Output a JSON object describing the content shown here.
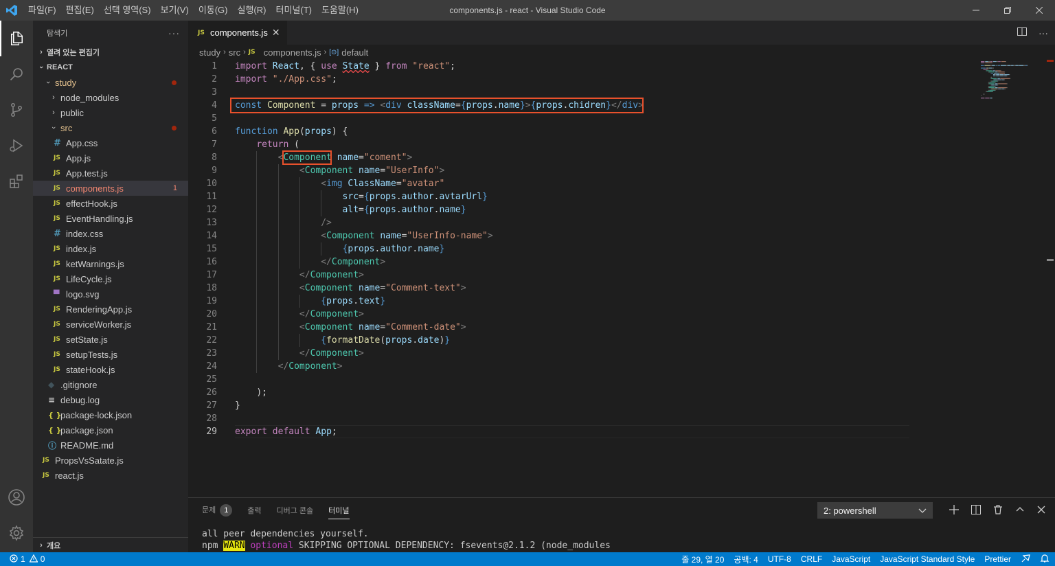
{
  "window": {
    "title": "components.js - react - Visual Studio Code",
    "menu": [
      "파일(F)",
      "편집(E)",
      "선택 영역(S)",
      "보기(V)",
      "이동(G)",
      "실행(R)",
      "터미널(T)",
      "도움말(H)"
    ]
  },
  "sidebar": {
    "title": "탐색기",
    "more": "···",
    "open_editors": "열려 있는 편집기",
    "workspace": "REACT",
    "outline": "개요",
    "tree": [
      {
        "label": "study",
        "type": "folder-open",
        "depth": 1,
        "status": "mod",
        "dot": true
      },
      {
        "label": "node_modules",
        "type": "folder",
        "depth": 2
      },
      {
        "label": "public",
        "type": "folder",
        "depth": 2
      },
      {
        "label": "src",
        "type": "folder-open",
        "depth": 2,
        "status": "mod",
        "dot": true
      },
      {
        "label": "App.css",
        "type": "css",
        "depth": 3
      },
      {
        "label": "App.js",
        "type": "js",
        "depth": 3
      },
      {
        "label": "App.test.js",
        "type": "js",
        "depth": 3
      },
      {
        "label": "components.js",
        "type": "js",
        "depth": 3,
        "status": "err",
        "badge": "1",
        "selected": true
      },
      {
        "label": "effectHook.js",
        "type": "js",
        "depth": 3
      },
      {
        "label": "EventHandling.js",
        "type": "js",
        "depth": 3
      },
      {
        "label": "index.css",
        "type": "css",
        "depth": 3
      },
      {
        "label": "index.js",
        "type": "js",
        "depth": 3
      },
      {
        "label": "ketWarnings.js",
        "type": "js",
        "depth": 3
      },
      {
        "label": "LifeCycle.js",
        "type": "js",
        "depth": 3
      },
      {
        "label": "logo.svg",
        "type": "svg",
        "depth": 3
      },
      {
        "label": "RenderingApp.js",
        "type": "js",
        "depth": 3
      },
      {
        "label": "serviceWorker.js",
        "type": "js",
        "depth": 3
      },
      {
        "label": "setState.js",
        "type": "js",
        "depth": 3
      },
      {
        "label": "setupTests.js",
        "type": "js",
        "depth": 3
      },
      {
        "label": "stateHook.js",
        "type": "js",
        "depth": 3
      },
      {
        "label": ".gitignore",
        "type": "git",
        "depth": 2
      },
      {
        "label": "debug.log",
        "type": "log",
        "depth": 2
      },
      {
        "label": "package-lock.json",
        "type": "json",
        "depth": 2
      },
      {
        "label": "package.json",
        "type": "json",
        "depth": 2
      },
      {
        "label": "README.md",
        "type": "info",
        "depth": 2
      },
      {
        "label": "PropsVsSatate.js",
        "type": "js",
        "depth": 1
      },
      {
        "label": "react.js",
        "type": "js",
        "depth": 1
      }
    ]
  },
  "editor": {
    "tab": "components.js",
    "breadcrumb": [
      "study",
      "src",
      "components.js",
      "default"
    ],
    "lines": [
      [
        [
          "kw2",
          "import"
        ],
        [
          "cm",
          " "
        ],
        [
          "var",
          "React"
        ],
        [
          "pun",
          ", { "
        ],
        [
          "kw2",
          "use"
        ],
        [
          "cm",
          " "
        ],
        [
          "var squig",
          "State"
        ],
        [
          "pun",
          " } "
        ],
        [
          "kw2",
          "from"
        ],
        [
          "cm",
          " "
        ],
        [
          "str",
          "\"react\""
        ],
        [
          "pun",
          ";"
        ]
      ],
      [
        [
          "kw2",
          "import"
        ],
        [
          "cm",
          " "
        ],
        [
          "str",
          "\"./App.css\""
        ],
        [
          "pun",
          ";"
        ]
      ],
      [],
      [
        [
          "kw",
          "const"
        ],
        [
          "cm",
          " "
        ],
        [
          "fn",
          "Component"
        ],
        [
          "pun",
          " = "
        ],
        [
          "var",
          "props"
        ],
        [
          "cm",
          " "
        ],
        [
          "kw",
          "=>"
        ],
        [
          "cm",
          " "
        ],
        [
          "br",
          "<"
        ],
        [
          "kw",
          "div"
        ],
        [
          "cm",
          " "
        ],
        [
          "var",
          "className"
        ],
        [
          "pun",
          "="
        ],
        [
          "jb",
          "{"
        ],
        [
          "var",
          "props"
        ],
        [
          "pun",
          "."
        ],
        [
          "var",
          "name"
        ],
        [
          "jb",
          "}"
        ],
        [
          "br",
          ">"
        ],
        [
          "jb",
          "{"
        ],
        [
          "var",
          "props"
        ],
        [
          "pun",
          "."
        ],
        [
          "var",
          "chidren"
        ],
        [
          "jb",
          "}"
        ],
        [
          "br",
          "</"
        ],
        [
          "kw",
          "div"
        ],
        [
          "br",
          ">"
        ]
      ],
      [],
      [
        [
          "kw",
          "function"
        ],
        [
          "cm",
          " "
        ],
        [
          "fn",
          "App"
        ],
        [
          "pun",
          "("
        ],
        [
          "var",
          "props"
        ],
        [
          "pun",
          ") {"
        ]
      ],
      [
        [
          "cm",
          "    "
        ],
        [
          "kw2",
          "return"
        ],
        [
          "pun",
          " ("
        ]
      ],
      [
        [
          "cm",
          "        "
        ],
        [
          "br",
          "<"
        ],
        [
          "tag",
          "Component"
        ],
        [
          "cm",
          " "
        ],
        [
          "var",
          "name"
        ],
        [
          "pun",
          "="
        ],
        [
          "str",
          "\"coment\""
        ],
        [
          "br",
          ">"
        ]
      ],
      [
        [
          "cm",
          "            "
        ],
        [
          "br",
          "<"
        ],
        [
          "tag",
          "Component"
        ],
        [
          "cm",
          " "
        ],
        [
          "var",
          "name"
        ],
        [
          "pun",
          "="
        ],
        [
          "str",
          "\"UserInfo\""
        ],
        [
          "br",
          ">"
        ]
      ],
      [
        [
          "cm",
          "                "
        ],
        [
          "br",
          "<"
        ],
        [
          "kw",
          "img"
        ],
        [
          "cm",
          " "
        ],
        [
          "var",
          "ClassName"
        ],
        [
          "pun",
          "="
        ],
        [
          "str",
          "\"avatar\""
        ]
      ],
      [
        [
          "cm",
          "                    "
        ],
        [
          "var",
          "src"
        ],
        [
          "pun",
          "="
        ],
        [
          "jb",
          "{"
        ],
        [
          "var",
          "props"
        ],
        [
          "pun",
          "."
        ],
        [
          "var",
          "author"
        ],
        [
          "pun",
          "."
        ],
        [
          "var",
          "avtarUrl"
        ],
        [
          "jb",
          "}"
        ]
      ],
      [
        [
          "cm",
          "                    "
        ],
        [
          "var",
          "alt"
        ],
        [
          "pun",
          "="
        ],
        [
          "jb",
          "{"
        ],
        [
          "var",
          "props"
        ],
        [
          "pun",
          "."
        ],
        [
          "var",
          "author"
        ],
        [
          "pun",
          "."
        ],
        [
          "var",
          "name"
        ],
        [
          "jb",
          "}"
        ]
      ],
      [
        [
          "cm",
          "                "
        ],
        [
          "br",
          "/>"
        ]
      ],
      [
        [
          "cm",
          "                "
        ],
        [
          "br",
          "<"
        ],
        [
          "tag",
          "Component"
        ],
        [
          "cm",
          " "
        ],
        [
          "var",
          "name"
        ],
        [
          "pun",
          "="
        ],
        [
          "str",
          "\"UserInfo-name\""
        ],
        [
          "br",
          ">"
        ]
      ],
      [
        [
          "cm",
          "                    "
        ],
        [
          "jb",
          "{"
        ],
        [
          "var",
          "props"
        ],
        [
          "pun",
          "."
        ],
        [
          "var",
          "author"
        ],
        [
          "pun",
          "."
        ],
        [
          "var",
          "name"
        ],
        [
          "jb",
          "}"
        ]
      ],
      [
        [
          "cm",
          "                "
        ],
        [
          "br",
          "</"
        ],
        [
          "tag",
          "Component"
        ],
        [
          "br",
          ">"
        ]
      ],
      [
        [
          "cm",
          "            "
        ],
        [
          "br",
          "</"
        ],
        [
          "tag",
          "Component"
        ],
        [
          "br",
          ">"
        ]
      ],
      [
        [
          "cm",
          "            "
        ],
        [
          "br",
          "<"
        ],
        [
          "tag",
          "Component"
        ],
        [
          "cm",
          " "
        ],
        [
          "var",
          "name"
        ],
        [
          "pun",
          "="
        ],
        [
          "str",
          "\"Comment-text\""
        ],
        [
          "br",
          ">"
        ]
      ],
      [
        [
          "cm",
          "                "
        ],
        [
          "jb",
          "{"
        ],
        [
          "var",
          "props"
        ],
        [
          "pun",
          "."
        ],
        [
          "var",
          "text"
        ],
        [
          "jb",
          "}"
        ]
      ],
      [
        [
          "cm",
          "            "
        ],
        [
          "br",
          "</"
        ],
        [
          "tag",
          "Component"
        ],
        [
          "br",
          ">"
        ]
      ],
      [
        [
          "cm",
          "            "
        ],
        [
          "br",
          "<"
        ],
        [
          "tag",
          "Component"
        ],
        [
          "cm",
          " "
        ],
        [
          "var",
          "name"
        ],
        [
          "pun",
          "="
        ],
        [
          "str",
          "\"Comment-date\""
        ],
        [
          "br",
          ">"
        ]
      ],
      [
        [
          "cm",
          "                "
        ],
        [
          "jb",
          "{"
        ],
        [
          "fn",
          "formatDate"
        ],
        [
          "pun",
          "("
        ],
        [
          "var",
          "props"
        ],
        [
          "pun",
          "."
        ],
        [
          "var",
          "date"
        ],
        [
          "pun",
          ")"
        ],
        [
          "jb",
          "}"
        ]
      ],
      [
        [
          "cm",
          "            "
        ],
        [
          "br",
          "</"
        ],
        [
          "tag",
          "Component"
        ],
        [
          "br",
          ">"
        ]
      ],
      [
        [
          "cm",
          "        "
        ],
        [
          "br",
          "</"
        ],
        [
          "tag",
          "Component"
        ],
        [
          "br",
          ">"
        ]
      ],
      [],
      [
        [
          "cm",
          "    "
        ],
        [
          "pun",
          ");"
        ]
      ],
      [
        [
          "pun",
          "}"
        ]
      ],
      [],
      [
        [
          "kw2",
          "export"
        ],
        [
          "cm",
          " "
        ],
        [
          "kw2",
          "default"
        ],
        [
          "cm",
          " "
        ],
        [
          "var",
          "App"
        ],
        [
          "pun",
          ";"
        ]
      ]
    ]
  },
  "panel": {
    "tabs": [
      "문제",
      "출력",
      "디버그 콘솔",
      "터미널"
    ],
    "problems_count": "1",
    "terminal_select": "2: powershell",
    "terminal_line1": "all peer dependencies yourself.",
    "terminal_line2_prefix": "npm ",
    "terminal_warn": "WARN",
    "terminal_optional": "optional",
    "terminal_line2_rest": " SKIPPING OPTIONAL DEPENDENCY: fsevents@2.1.2 (node_modules"
  },
  "statusbar": {
    "errors": "1",
    "warnings": "0",
    "position": "줄 29, 열 20",
    "spaces": "공백: 4",
    "encoding": "UTF-8",
    "eol": "CRLF",
    "language": "JavaScript",
    "linter": "JavaScript Standard Style",
    "formatter": "Prettier"
  },
  "colors": {
    "accent": "#007acc",
    "highlight_box": "#e8512c"
  }
}
